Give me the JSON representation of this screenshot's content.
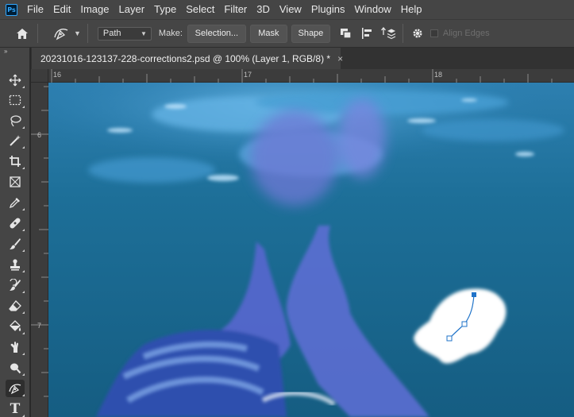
{
  "app": {
    "logo_text": "Ps",
    "menu": [
      "File",
      "Edit",
      "Image",
      "Layer",
      "Type",
      "Select",
      "Filter",
      "3D",
      "View",
      "Plugins",
      "Window",
      "Help"
    ]
  },
  "options": {
    "mode_value": "Path",
    "make_label": "Make:",
    "selection_label": "Selection...",
    "mask_label": "Mask",
    "shape_label": "Shape",
    "align_edges_label": "Align Edges"
  },
  "document": {
    "tab_title": "20231016-123137-228-corrections2.psd @ 100% (Layer 1, RGB/8) *",
    "close_glyph": "×"
  },
  "rulers": {
    "top_labels": [
      "16",
      "17",
      "18"
    ],
    "left_labels": [
      "6",
      "7"
    ]
  },
  "toolbar": {
    "collapse_glyph": "»",
    "tools": [
      "move",
      "marquee",
      "lasso",
      "magic-wand",
      "crop",
      "frame",
      "eyedropper",
      "healing-brush",
      "brush",
      "clone-stamp",
      "history-brush",
      "eraser",
      "paint-bucket",
      "smudge",
      "dodge",
      "pen",
      "type"
    ],
    "active_tool": "pen",
    "type_glyph": "T"
  },
  "colors": {
    "accent_blue": "#31a8ff",
    "water": "#1a6a8f",
    "path_anchor": "#1f73c9"
  }
}
